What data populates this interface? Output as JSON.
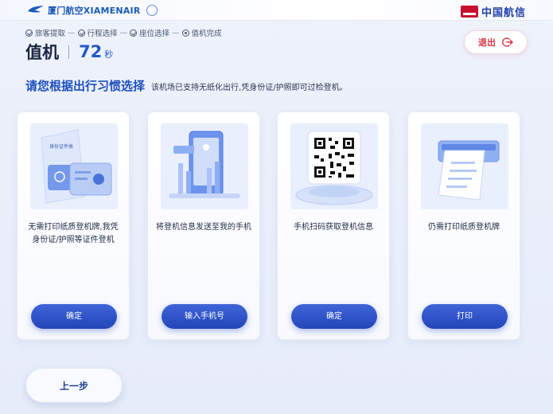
{
  "header": {
    "airline_logo_text": "厦门航空XIAMENAIR",
    "partner_logo_text": "中国航信",
    "partner_logo_badge": "TravelSky"
  },
  "steps": [
    {
      "label": "旅客提取",
      "state": "done"
    },
    {
      "label": "行程选择",
      "state": "done"
    },
    {
      "label": "座位选择",
      "state": "done"
    },
    {
      "label": "值机完成",
      "state": "current"
    }
  ],
  "step_separator": "—",
  "page": {
    "title": "值机",
    "countdown": "72",
    "countdown_unit": "秒"
  },
  "exit_button": {
    "label": "退出",
    "icon": "logout-icon"
  },
  "prompt": {
    "main": "请您根据出行习惯选择",
    "sub": "该机场已支持无纸化出行,凭身份证/护照即可过检登机。"
  },
  "options": [
    {
      "description": "无需打印纸质登机牌,我凭身份证/护照等证件登机",
      "button": "确定",
      "art": "id-card-illustration",
      "art_text": "身份证件类"
    },
    {
      "description": "将登机信息发送至我的手机",
      "button": "输入手机号",
      "art": "phone-illustration"
    },
    {
      "description": "手机扫码获取登机信息",
      "button": "确定",
      "art": "qr-code-illustration"
    },
    {
      "description": "仍需打印纸质登机牌",
      "button": "打印",
      "art": "printer-illustration"
    }
  ],
  "back_button": {
    "label": "上一步"
  },
  "colors": {
    "primary": "#2346b8",
    "accent_blue": "#2457c5",
    "exit_red": "#d8343f",
    "background": "#eef2fb"
  }
}
